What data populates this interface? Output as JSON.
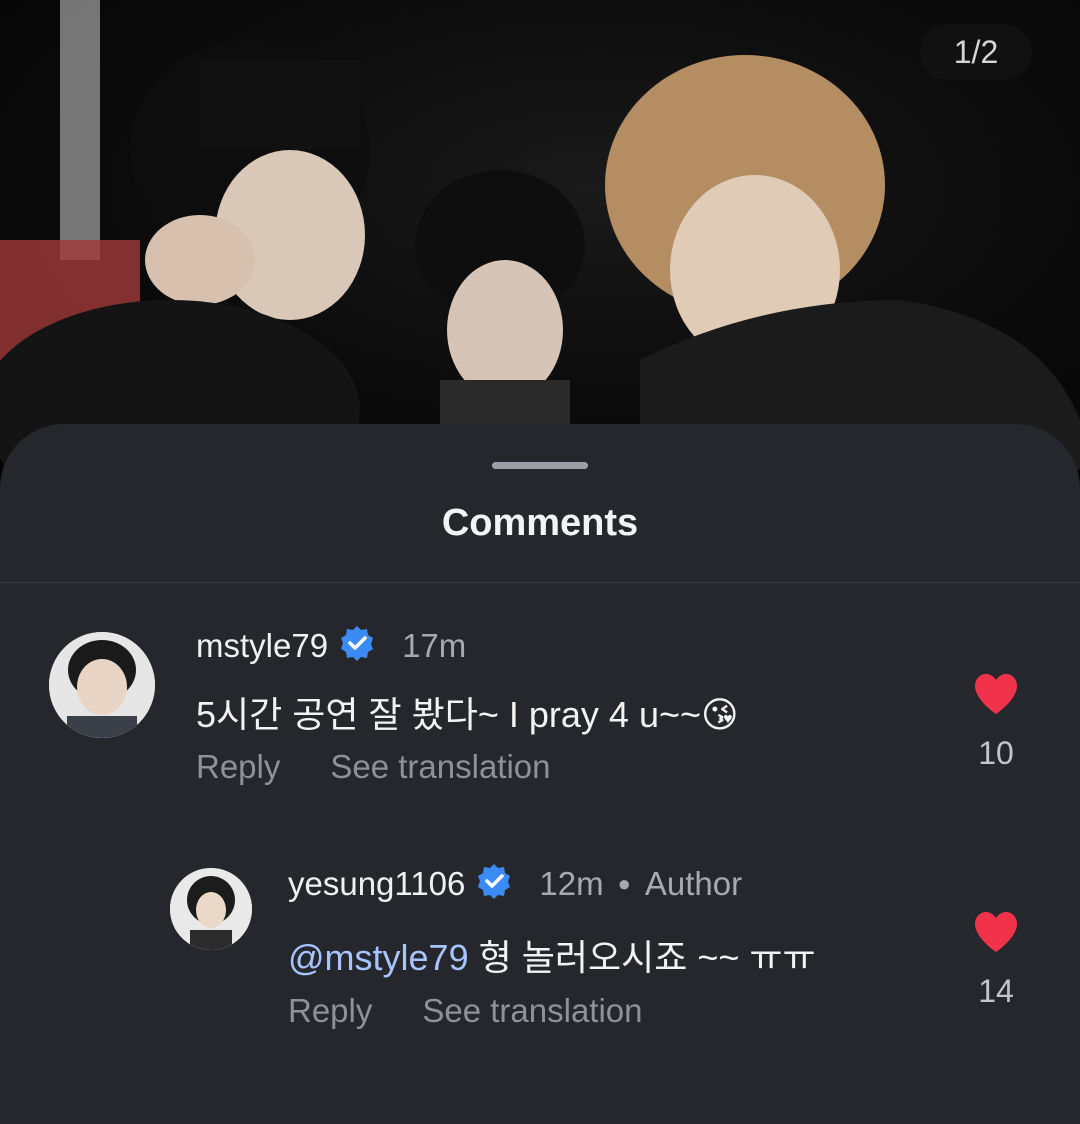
{
  "photo": {
    "counter": "1/2"
  },
  "sheet": {
    "title": "Comments"
  },
  "comments": [
    {
      "username": "mstyle79",
      "time": "17m",
      "text": "5시간 공연 잘 봤다~ I pray 4 u~~",
      "emoji": "😘",
      "reply_label": "Reply",
      "translate_label": "See translation",
      "likes": "10"
    },
    {
      "username": "yesung1106",
      "time": "12m",
      "author_label": "Author",
      "mention": "@mstyle79",
      "text": " 형 놀러오시죠 ~~ ㅠㅠ",
      "reply_label": "Reply",
      "translate_label": "See translation",
      "likes": "14"
    }
  ],
  "colors": {
    "sheet_bg": "#25272c",
    "heart": "#f0334b",
    "verified": "#3a8bf5",
    "mention": "#a7c4ff"
  }
}
